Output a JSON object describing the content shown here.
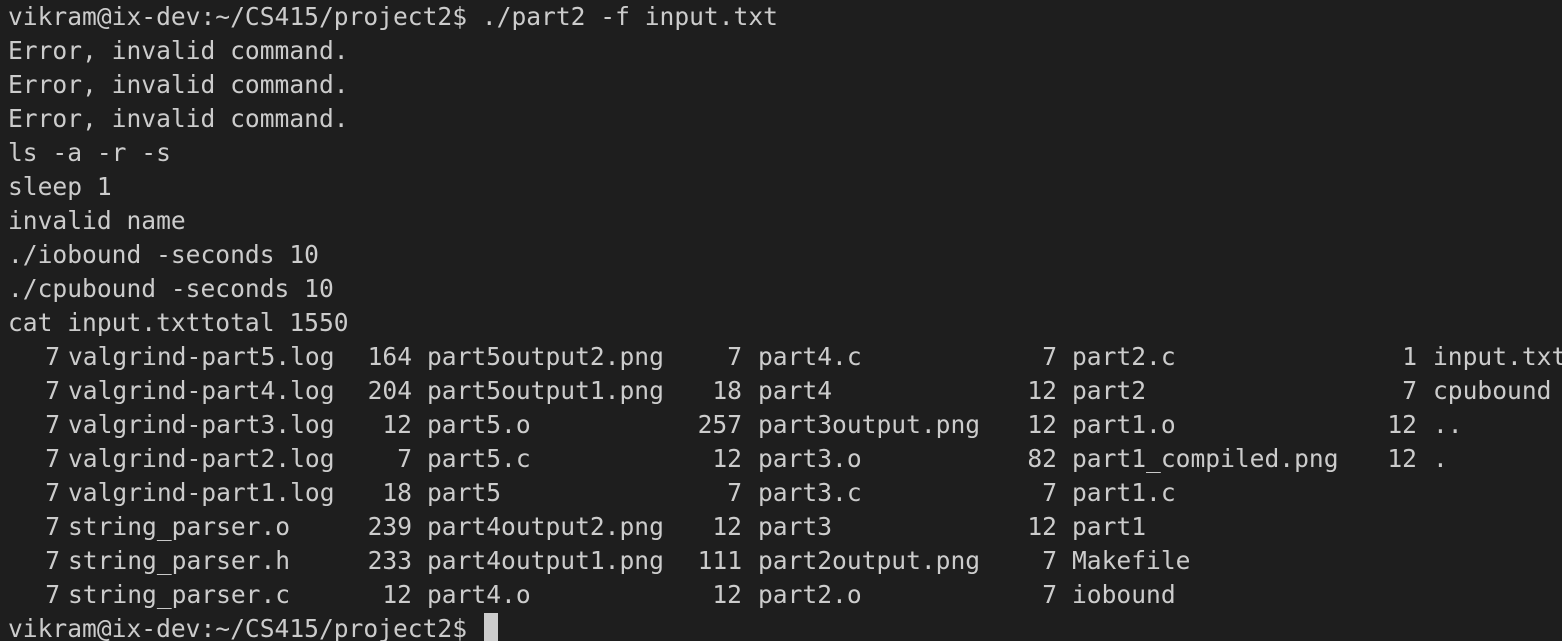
{
  "terminal": {
    "prompt": "vikram@ix-dev:~/CS415/project2$ ",
    "command": "./part2 -f input.txt",
    "output_lines": [
      "Error, invalid command.",
      "Error, invalid command.",
      "Error, invalid command.",
      "ls -a -r -s",
      "sleep 1",
      "invalid name",
      "./iobound -seconds 10",
      "./cpubound -seconds 10",
      "cat input.txttotal 1550"
    ],
    "listing": [
      [
        {
          "size": "7",
          "name": "valgrind-part5.log"
        },
        {
          "size": "164",
          "name": "part5output2.png"
        },
        {
          "size": "7",
          "name": "part4.c"
        },
        {
          "size": "7",
          "name": "part2.c"
        },
        {
          "size": "1",
          "name": "input.txt"
        }
      ],
      [
        {
          "size": "7",
          "name": "valgrind-part4.log"
        },
        {
          "size": "204",
          "name": "part5output1.png"
        },
        {
          "size": "18",
          "name": "part4"
        },
        {
          "size": "12",
          "name": "part2"
        },
        {
          "size": "7",
          "name": "cpubound"
        }
      ],
      [
        {
          "size": "7",
          "name": "valgrind-part3.log"
        },
        {
          "size": "12",
          "name": "part5.o"
        },
        {
          "size": "257",
          "name": "part3output.png"
        },
        {
          "size": "12",
          "name": "part1.o"
        },
        {
          "size": "12",
          "name": ".."
        }
      ],
      [
        {
          "size": "7",
          "name": "valgrind-part2.log"
        },
        {
          "size": "7",
          "name": "part5.c"
        },
        {
          "size": "12",
          "name": "part3.o"
        },
        {
          "size": "82",
          "name": "part1_compiled.png"
        },
        {
          "size": "12",
          "name": "."
        }
      ],
      [
        {
          "size": "7",
          "name": "valgrind-part1.log"
        },
        {
          "size": "18",
          "name": "part5"
        },
        {
          "size": "7",
          "name": "part3.c"
        },
        {
          "size": "7",
          "name": "part1.c"
        }
      ],
      [
        {
          "size": "7",
          "name": "string_parser.o"
        },
        {
          "size": "239",
          "name": "part4output2.png"
        },
        {
          "size": "12",
          "name": "part3"
        },
        {
          "size": "12",
          "name": "part1"
        }
      ],
      [
        {
          "size": "7",
          "name": "string_parser.h"
        },
        {
          "size": "233",
          "name": "part4output1.png"
        },
        {
          "size": "111",
          "name": "part2output.png"
        },
        {
          "size": "7",
          "name": "Makefile"
        }
      ],
      [
        {
          "size": "7",
          "name": "string_parser.c"
        },
        {
          "size": "12",
          "name": "part4.o"
        },
        {
          "size": "12",
          "name": "part2.o"
        },
        {
          "size": "7",
          "name": "iobound"
        }
      ]
    ],
    "final_prompt": "vikram@ix-dev:~/CS415/project2$ "
  },
  "colors": {
    "background": "#1e1e1e",
    "foreground": "#cccccc"
  }
}
